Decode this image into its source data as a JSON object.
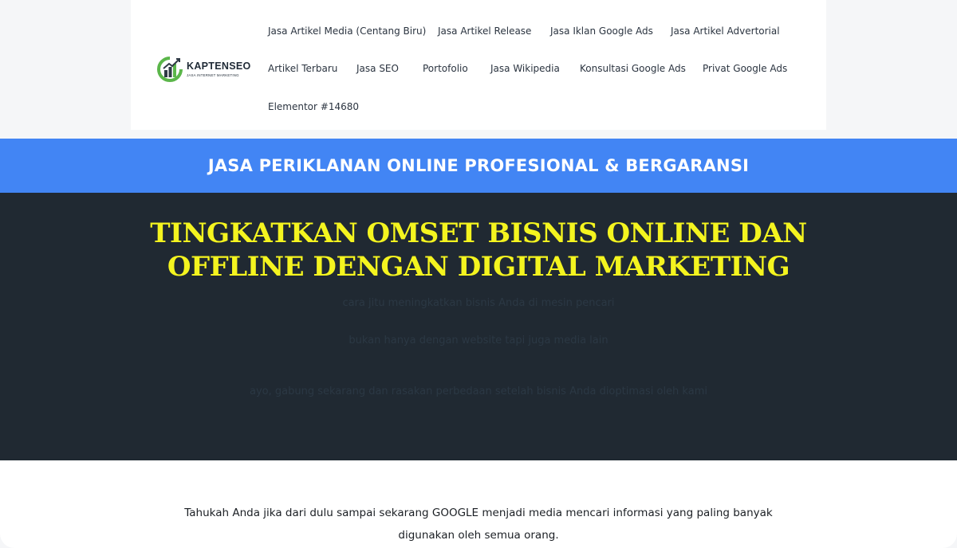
{
  "logo": {
    "name": "KAPTENSEO",
    "tagline": "JASA INTERNET MARKETING",
    "colors": {
      "green": "#5bb64a",
      "dark": "#2f3a45"
    }
  },
  "nav": {
    "items": [
      {
        "label": "Jasa Artikel Media (Centang Biru)"
      },
      {
        "label": "Jasa Artikel Release"
      },
      {
        "label": "Jasa Iklan Google Ads"
      },
      {
        "label": "Jasa Artikel Advertorial"
      },
      {
        "label": "Artikel Terbaru"
      },
      {
        "label": "Jasa SEO"
      },
      {
        "label": "Portofolio"
      },
      {
        "label": "Jasa Wikipedia"
      },
      {
        "label": "Konsultasi Google Ads"
      },
      {
        "label": "Privat Google Ads"
      },
      {
        "label": "Elementor #14680"
      }
    ]
  },
  "banner": {
    "text": "JASA PERIKLANAN ONLINE PROFESIONAL & BERGARANSI",
    "color": "#4285f4"
  },
  "hero": {
    "title_line1": "TINGKATKAN OMSET BISNIS ONLINE DAN",
    "title_line2": "OFFLINE DENGAN DIGITAL MARKETING",
    "line1": "cara jitu meningkatkan bisnis Anda di mesin pencari",
    "line2": "bukan hanya dengan website tapi juga media lain",
    "line3": "ayo, gabung sekarang dan rasakan perbedaan setelah bisnis Anda dioptimasi oleh kami",
    "colors": {
      "background": "#202932",
      "title": "#f4f41f"
    }
  },
  "content": {
    "intro": "Tahukah Anda jika dari dulu sampai sekarang GOOGLE menjadi media mencari informasi yang paling banyak digunakan oleh semua orang."
  }
}
